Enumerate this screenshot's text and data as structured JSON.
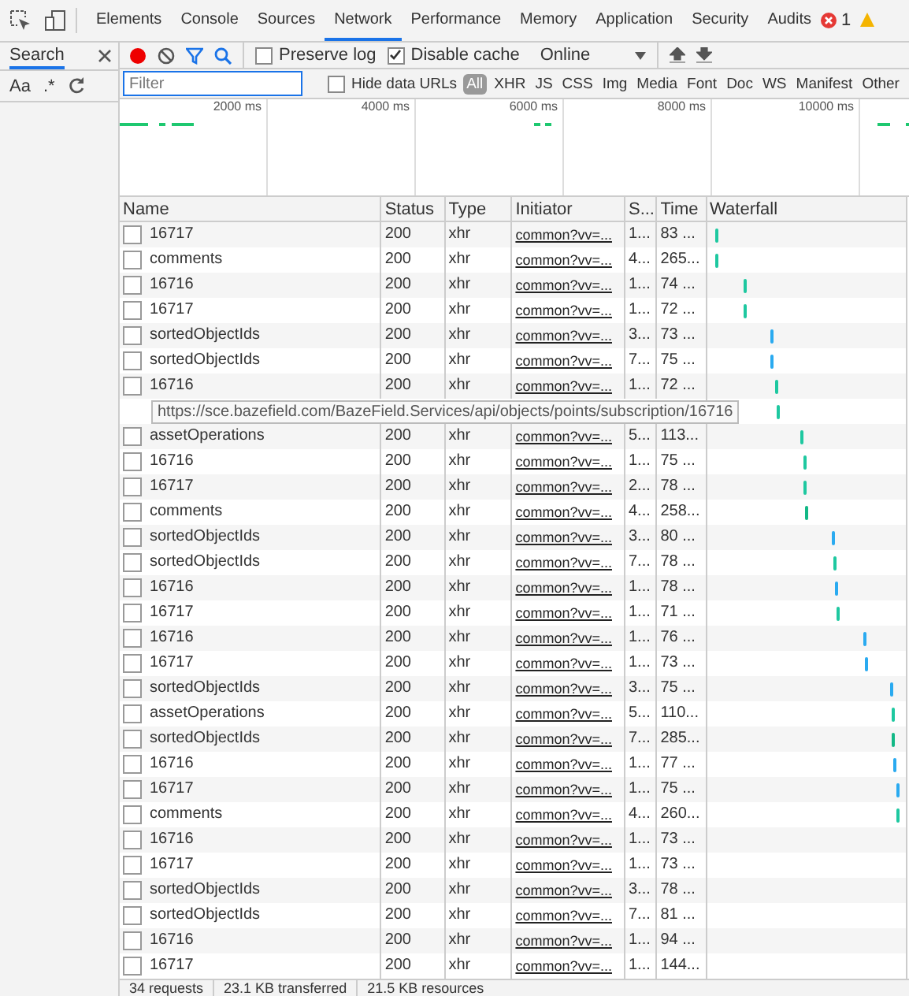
{
  "tabs": [
    {
      "label": "Elements",
      "selected": false
    },
    {
      "label": "Console",
      "selected": false
    },
    {
      "label": "Sources",
      "selected": false
    },
    {
      "label": "Network",
      "selected": true
    },
    {
      "label": "Performance",
      "selected": false
    },
    {
      "label": "Memory",
      "selected": false
    },
    {
      "label": "Application",
      "selected": false
    },
    {
      "label": "Security",
      "selected": false
    },
    {
      "label": "Audits",
      "selected": false
    }
  ],
  "error_count": "1",
  "search_panel": {
    "title": "Search",
    "case_toggle": "Aa",
    "regex_toggle": ".*"
  },
  "toolbar": {
    "recording": true,
    "preserve_log": {
      "label": "Preserve log",
      "checked": false
    },
    "disable_cache": {
      "label": "Disable cache",
      "checked": true
    },
    "throttling": "Online"
  },
  "filter": {
    "placeholder": "Filter",
    "hide_data_urls": {
      "label": "Hide data URLs",
      "checked": false
    },
    "types": [
      {
        "label": "All",
        "selected": true
      },
      {
        "label": "XHR",
        "selected": false
      },
      {
        "label": "JS",
        "selected": false
      },
      {
        "label": "CSS",
        "selected": false
      },
      {
        "label": "Img",
        "selected": false
      },
      {
        "label": "Media",
        "selected": false
      },
      {
        "label": "Font",
        "selected": false
      },
      {
        "label": "Doc",
        "selected": false
      },
      {
        "label": "WS",
        "selected": false
      },
      {
        "label": "Manifest",
        "selected": false
      },
      {
        "label": "Other",
        "selected": false
      }
    ]
  },
  "overview": {
    "ticks": [
      "2000 ms",
      "4000 ms",
      "6000 ms",
      "8000 ms",
      "10000 ms"
    ]
  },
  "table": {
    "columns": [
      "Name",
      "Status",
      "Type",
      "Initiator",
      "S...",
      "Time",
      "Waterfall"
    ],
    "rows": [
      {
        "name": "16717",
        "status": "200",
        "type": "xhr",
        "initiator": "common?vv=...",
        "size": "1...",
        "time": "83 ...",
        "level": 0.03,
        "color": "#1ec8a0"
      },
      {
        "name": "comments",
        "status": "200",
        "type": "xhr",
        "initiator": "common?vv=...",
        "size": "4...",
        "time": "265...",
        "level": 0.03,
        "color": "#1ec8a0"
      },
      {
        "name": "16716",
        "status": "200",
        "type": "xhr",
        "initiator": "common?vv=...",
        "size": "1...",
        "time": "74 ...",
        "level": 0.18,
        "color": "#1ec8a0"
      },
      {
        "name": "16717",
        "status": "200",
        "type": "xhr",
        "initiator": "common?vv=...",
        "size": "1...",
        "time": "72 ...",
        "level": 0.18,
        "color": "#1ec8a0"
      },
      {
        "name": "sortedObjectIds",
        "status": "200",
        "type": "xhr",
        "initiator": "common?vv=...",
        "size": "3...",
        "time": "73 ...",
        "level": 0.32,
        "color": "#2aaaf0"
      },
      {
        "name": "sortedObjectIds",
        "status": "200",
        "type": "xhr",
        "initiator": "common?vv=...",
        "size": "7...",
        "time": "75 ...",
        "level": 0.32,
        "color": "#2aaaf0"
      },
      {
        "name": "16716",
        "status": "200",
        "type": "xhr",
        "initiator": "common?vv=...",
        "size": "1...",
        "time": "72 ...",
        "level": 0.34,
        "color": "#1ec8a0"
      },
      {
        "kind": "covered",
        "level": 0.35,
        "color": "#1ec8a0"
      },
      {
        "name": "assetOperations",
        "status": "200",
        "type": "xhr",
        "initiator": "common?vv=...",
        "size": "5...",
        "time": "113...",
        "level": 0.48,
        "color": "#1ec8a0"
      },
      {
        "name": "16716",
        "status": "200",
        "type": "xhr",
        "initiator": "common?vv=...",
        "size": "1...",
        "time": "75 ...",
        "level": 0.49,
        "color": "#1ec8a0"
      },
      {
        "name": "16717",
        "status": "200",
        "type": "xhr",
        "initiator": "common?vv=...",
        "size": "2...",
        "time": "78 ...",
        "level": 0.49,
        "color": "#1ec8a0"
      },
      {
        "name": "comments",
        "status": "200",
        "type": "xhr",
        "initiator": "common?vv=...",
        "size": "4...",
        "time": "258...",
        "level": 0.5,
        "color": "#12b886"
      },
      {
        "name": "sortedObjectIds",
        "status": "200",
        "type": "xhr",
        "initiator": "common?vv=...",
        "size": "3...",
        "time": "80 ...",
        "level": 0.64,
        "color": "#2aaaf0"
      },
      {
        "name": "sortedObjectIds",
        "status": "200",
        "type": "xhr",
        "initiator": "common?vv=...",
        "size": "7...",
        "time": "78 ...",
        "level": 0.65,
        "color": "#1ec8a0"
      },
      {
        "name": "16716",
        "status": "200",
        "type": "xhr",
        "initiator": "common?vv=...",
        "size": "1...",
        "time": "78 ...",
        "level": 0.66,
        "color": "#2aaaf0"
      },
      {
        "name": "16717",
        "status": "200",
        "type": "xhr",
        "initiator": "common?vv=...",
        "size": "1...",
        "time": "71 ...",
        "level": 0.67,
        "color": "#1ec8a0"
      },
      {
        "name": "16716",
        "status": "200",
        "type": "xhr",
        "initiator": "common?vv=...",
        "size": "1...",
        "time": "76 ...",
        "level": 0.81,
        "color": "#2aaaf0"
      },
      {
        "name": "16717",
        "status": "200",
        "type": "xhr",
        "initiator": "common?vv=...",
        "size": "1...",
        "time": "73 ...",
        "level": 0.82,
        "color": "#2aaaf0"
      },
      {
        "name": "sortedObjectIds",
        "status": "200",
        "type": "xhr",
        "initiator": "common?vv=...",
        "size": "3...",
        "time": "75 ...",
        "level": 0.95,
        "color": "#2aaaf0"
      },
      {
        "name": "assetOperations",
        "status": "200",
        "type": "xhr",
        "initiator": "common?vv=...",
        "size": "5...",
        "time": "110...",
        "level": 0.96,
        "color": "#1ec8a0"
      },
      {
        "name": "sortedObjectIds",
        "status": "200",
        "type": "xhr",
        "initiator": "common?vv=...",
        "size": "7...",
        "time": "285...",
        "level": 0.96,
        "color": "#12b886"
      },
      {
        "name": "16716",
        "status": "200",
        "type": "xhr",
        "initiator": "common?vv=...",
        "size": "1...",
        "time": "77 ...",
        "level": 0.97,
        "color": "#2aaaf0"
      },
      {
        "name": "16717",
        "status": "200",
        "type": "xhr",
        "initiator": "common?vv=...",
        "size": "1...",
        "time": "75 ...",
        "level": 0.98,
        "color": "#2aaaf0"
      },
      {
        "name": "comments",
        "status": "200",
        "type": "xhr",
        "initiator": "common?vv=...",
        "size": "4...",
        "time": "260...",
        "level": 0.98,
        "color": "#1ec8a0"
      },
      {
        "name": "16716",
        "status": "200",
        "type": "xhr",
        "initiator": "common?vv=...",
        "size": "1...",
        "time": "73 ..."
      },
      {
        "name": "16717",
        "status": "200",
        "type": "xhr",
        "initiator": "common?vv=...",
        "size": "1...",
        "time": "73 ..."
      },
      {
        "name": "sortedObjectIds",
        "status": "200",
        "type": "xhr",
        "initiator": "common?vv=...",
        "size": "3...",
        "time": "78 ..."
      },
      {
        "name": "sortedObjectIds",
        "status": "200",
        "type": "xhr",
        "initiator": "common?vv=...",
        "size": "7...",
        "time": "81 ..."
      },
      {
        "name": "16716",
        "status": "200",
        "type": "xhr",
        "initiator": "common?vv=...",
        "size": "1...",
        "time": "94 ..."
      },
      {
        "name": "16717",
        "status": "200",
        "type": "xhr",
        "initiator": "common?vv=...",
        "size": "1...",
        "time": "144..."
      }
    ]
  },
  "tooltip": {
    "text": "https://sce.bazefield.com/BazeField.Services/api/objects/points/subscription/16716"
  },
  "status_bar": [
    "34 requests",
    "23.1 KB transferred",
    "21.5 KB resources"
  ]
}
